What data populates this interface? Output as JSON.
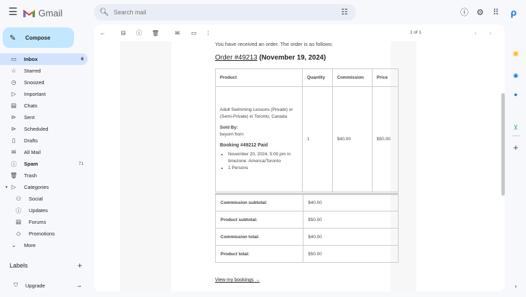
{
  "header": {
    "logo_text": "Gmail",
    "search_placeholder": "Search mail"
  },
  "sidebar": {
    "compose_label": "Compose",
    "items": [
      {
        "label": "Inbox",
        "count": "6",
        "icon": "inbox-icon",
        "active": true
      },
      {
        "label": "Starred",
        "icon": "star-icon"
      },
      {
        "label": "Snoozed",
        "icon": "clock-icon"
      },
      {
        "label": "Important",
        "icon": "label-important-icon"
      },
      {
        "label": "Chats",
        "icon": "chat-icon"
      },
      {
        "label": "Sent",
        "icon": "send-icon"
      },
      {
        "label": "Scheduled",
        "icon": "schedule-send-icon"
      },
      {
        "label": "Drafts",
        "icon": "draft-icon"
      },
      {
        "label": "All Mail",
        "icon": "all-mail-icon"
      },
      {
        "label": "Spam",
        "count": "71",
        "icon": "spam-icon"
      },
      {
        "label": "Trash",
        "icon": "trash-icon"
      },
      {
        "label": "Categories",
        "icon": "label-icon"
      },
      {
        "label": "Social",
        "icon": "people-icon"
      },
      {
        "label": "Updates",
        "icon": "info-icon"
      },
      {
        "label": "Forums",
        "icon": "forum-icon"
      },
      {
        "label": "Promotions",
        "icon": "tag-icon"
      },
      {
        "label": "More",
        "icon": "chevron-down-icon"
      }
    ],
    "labels_heading": "Labels",
    "upgrade_label": "Upgrade"
  },
  "toolbar": {
    "pager": "1 of 1"
  },
  "email": {
    "intro": "You have received an order. The order is as follows:",
    "order_link": "Order #49213",
    "order_date": "(November 19, 2024)",
    "columns": [
      "Product",
      "Quantity",
      "Commission",
      "Price"
    ],
    "product_name": "Adult Swimming Lessons (Private) or (Semi-Private) in Toronto, Canada",
    "sold_by_label": "Sold By:",
    "sold_by_value": "beyorn horn",
    "booking_label": "Booking #49212 Paid",
    "booking_details": [
      "November 20, 2024, 5:00 pm in timezone: America/Toronto",
      "1 Persons"
    ],
    "quantity": "1",
    "commission": "$40.00",
    "price": "$50.00",
    "totals": [
      {
        "label": "Commission subtotal:",
        "value": "$40.00"
      },
      {
        "label": "Product subtotal:",
        "value": "$50.00"
      },
      {
        "label": "Commission total:",
        "value": "$40.00"
      },
      {
        "label": "Product total:",
        "value": "$50.00"
      }
    ],
    "bookings_link": "View my bookings →"
  },
  "colors": {
    "accent": "#c2e7ff",
    "active_nav": "#d3e3fd",
    "background": "#f6f8fc"
  }
}
